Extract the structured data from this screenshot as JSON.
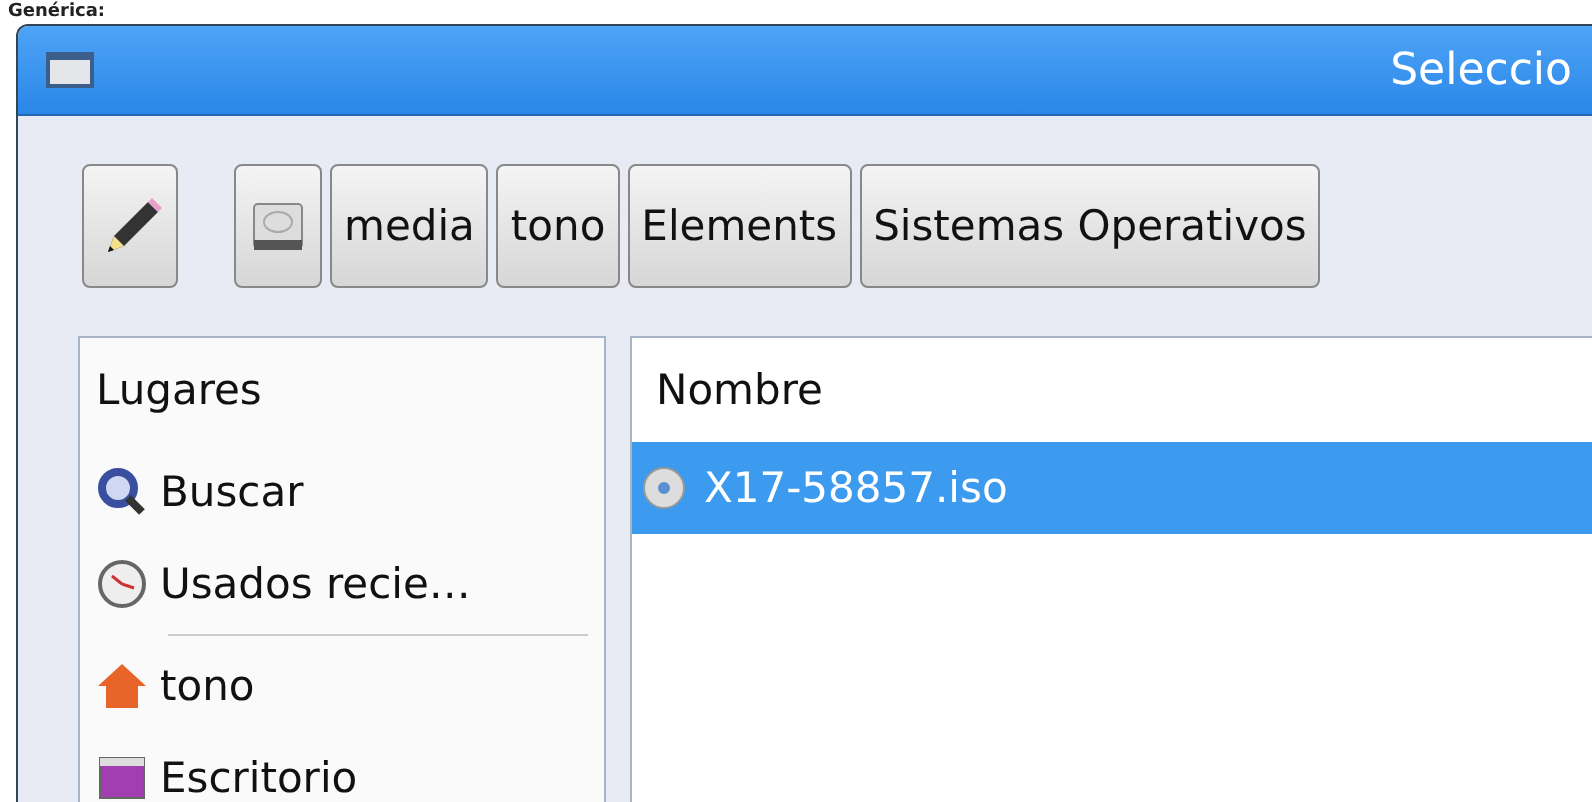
{
  "caption": "Genérica:",
  "window": {
    "title": "Seleccio"
  },
  "path_bar": [
    {
      "kind": "edit"
    },
    {
      "kind": "drive"
    },
    {
      "kind": "folder",
      "label": "media"
    },
    {
      "kind": "folder",
      "label": "tono"
    },
    {
      "kind": "folder",
      "label": "Elements"
    },
    {
      "kind": "folder",
      "label": "Sistemas Operativos"
    }
  ],
  "sidebar": {
    "heading": "Lugares",
    "items": [
      {
        "kind": "search",
        "label": "Buscar",
        "selected": false
      },
      {
        "kind": "recent",
        "label": "Usados recie…",
        "selected": false
      },
      {
        "kind": "separator"
      },
      {
        "kind": "home",
        "label": "tono",
        "selected": false
      },
      {
        "kind": "desktop",
        "label": "Escritorio",
        "selected": false
      }
    ]
  },
  "files": {
    "columns": [
      "Nombre"
    ],
    "rows": [
      {
        "name": "X17-58857.iso",
        "selected": true
      }
    ]
  }
}
